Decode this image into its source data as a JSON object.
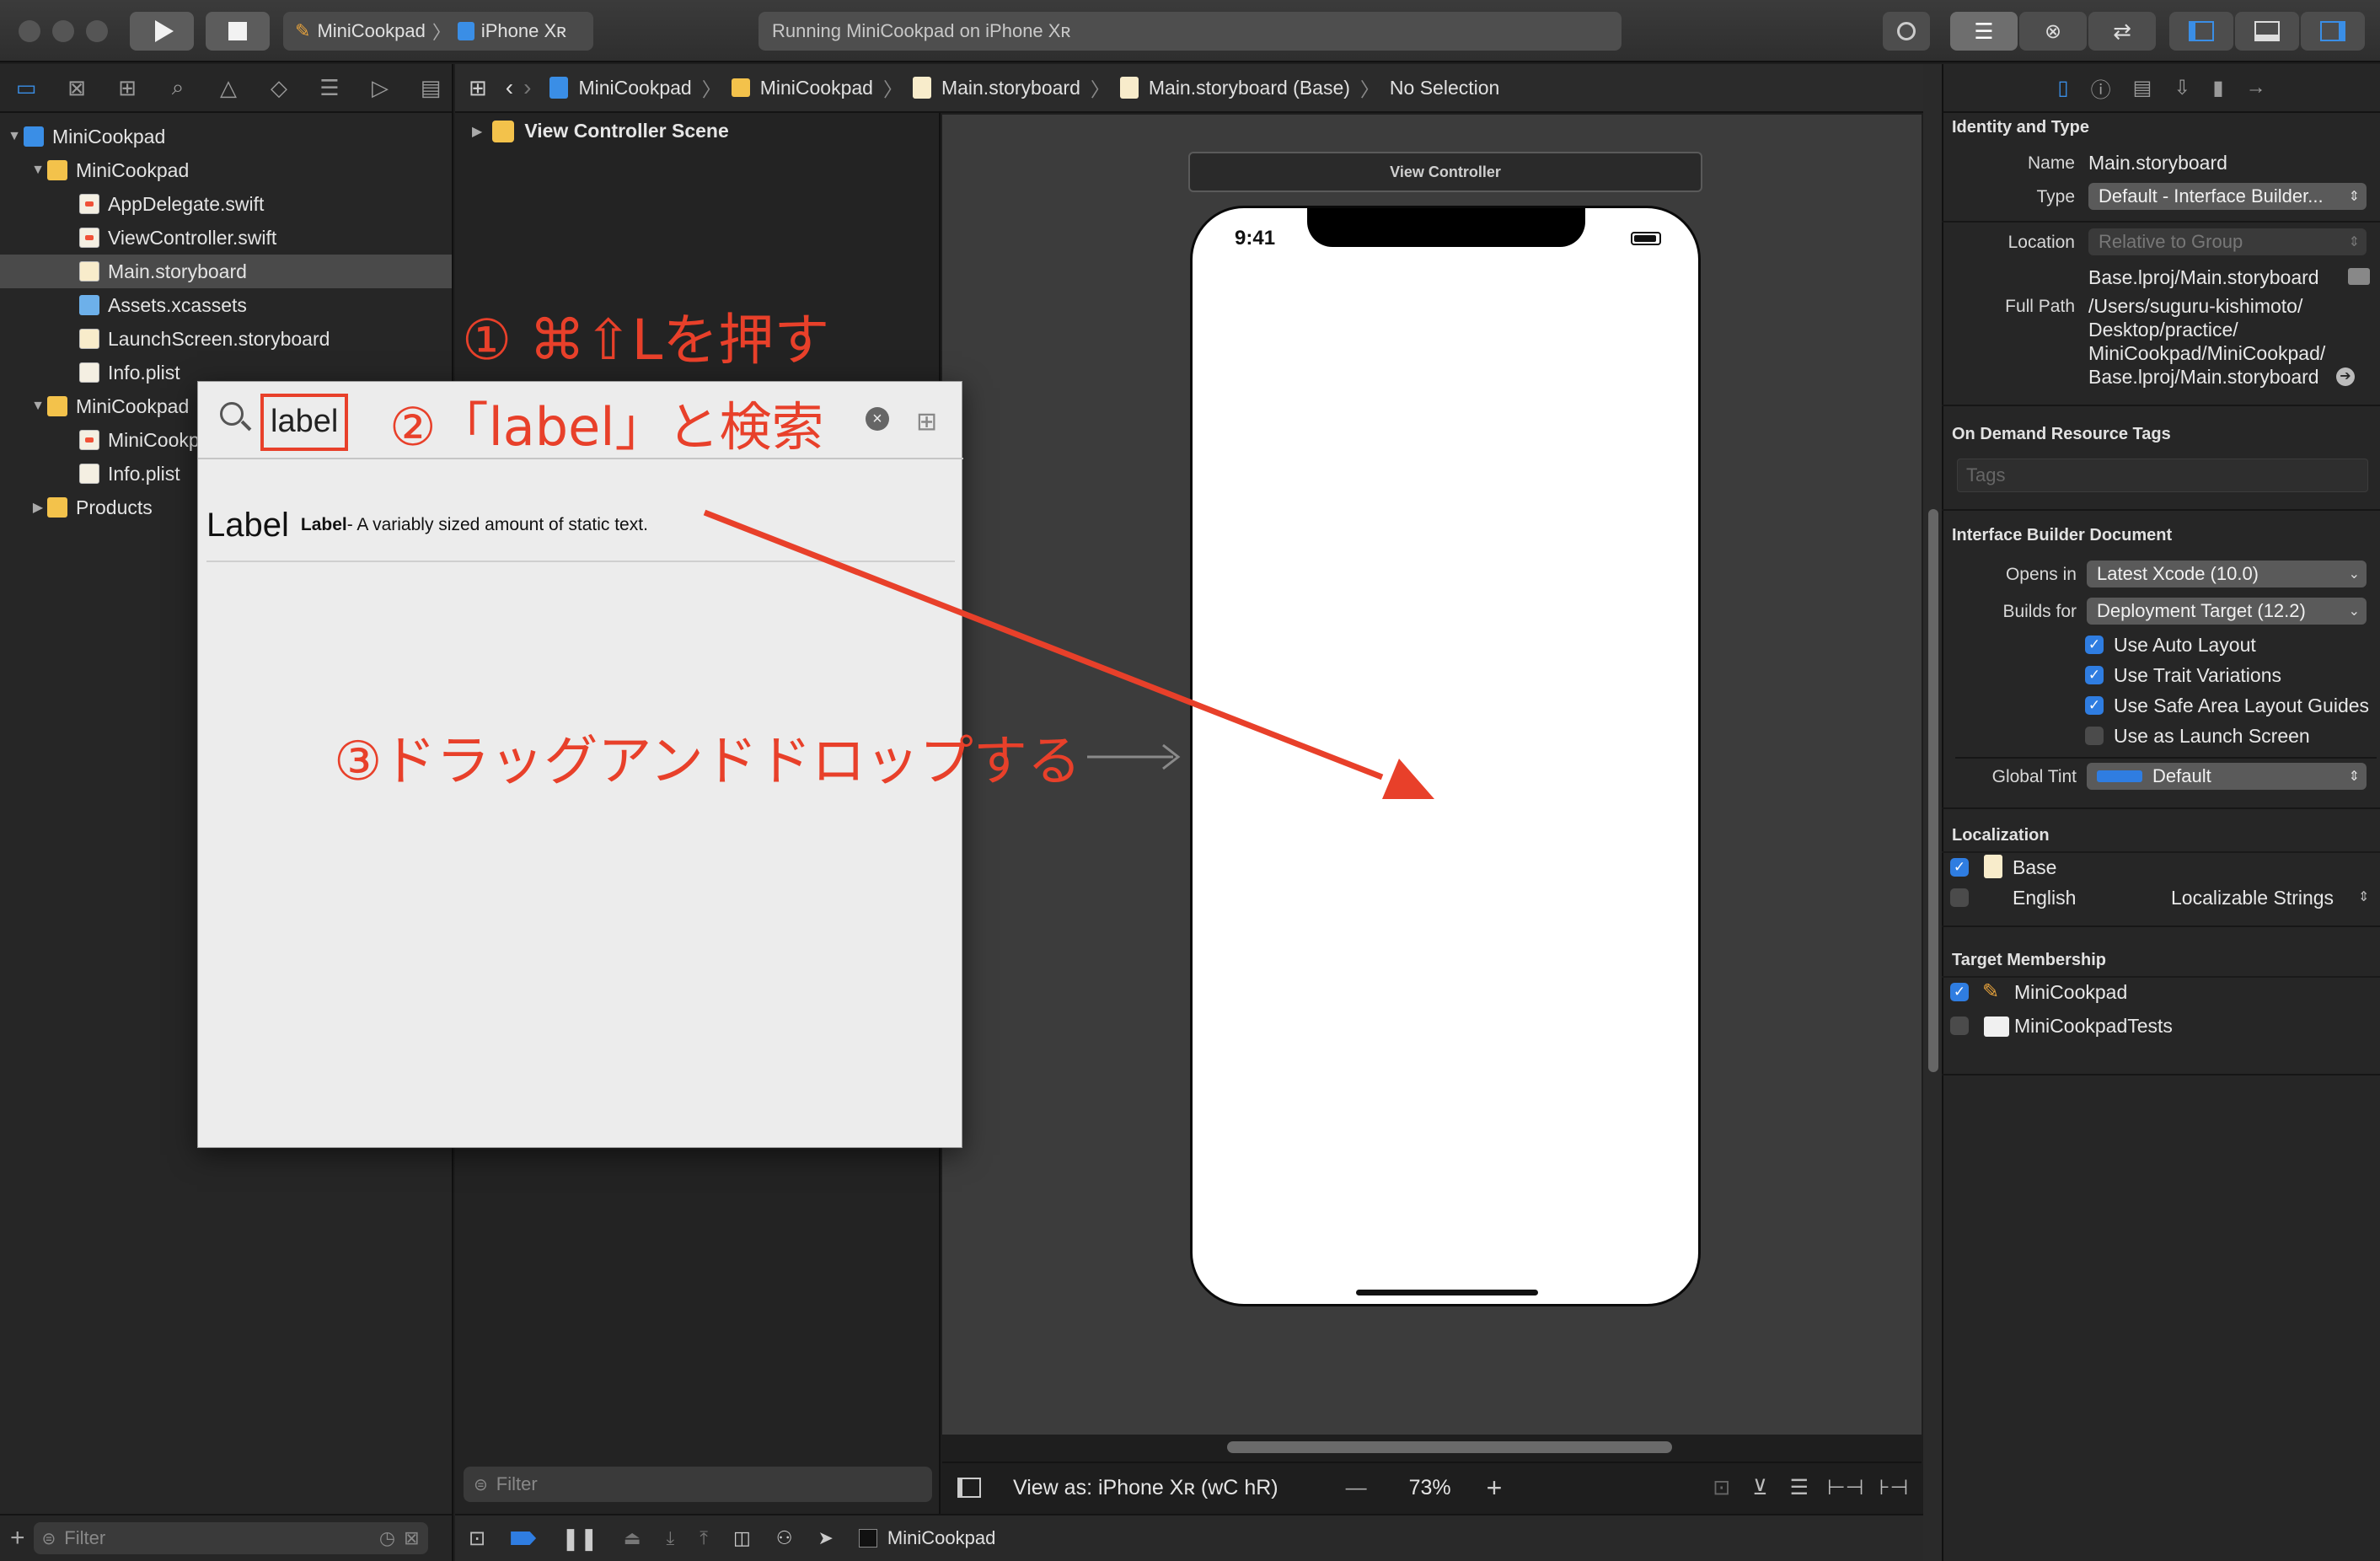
{
  "toolbar": {
    "scheme_name": "MiniCookpad",
    "scheme_separator": "〉",
    "device": "iPhone Xʀ",
    "status": "Running MiniCookpad on iPhone Xʀ"
  },
  "navigator": {
    "icons": [
      "folder-icon",
      "source-control-icon",
      "hierarchy-icon",
      "search-icon",
      "warning-icon",
      "test-diamond-icon",
      "debug-icon",
      "breakpoint-icon",
      "report-icon"
    ],
    "items": [
      {
        "label": "MiniCookpad",
        "kind": "project"
      },
      {
        "label": "MiniCookpad",
        "kind": "folder"
      },
      {
        "label": "AppDelegate.swift",
        "kind": "swift"
      },
      {
        "label": "ViewController.swift",
        "kind": "swift"
      },
      {
        "label": "Main.storyboard",
        "kind": "storyboard"
      },
      {
        "label": "Assets.xcassets",
        "kind": "assets"
      },
      {
        "label": "LaunchScreen.storyboard",
        "kind": "storyboard"
      },
      {
        "label": "Info.plist",
        "kind": "plist"
      },
      {
        "label": "MiniCookpad",
        "kind": "folder"
      },
      {
        "label": "MiniCookp",
        "kind": "swift"
      },
      {
        "label": "Info.plist",
        "kind": "plist"
      },
      {
        "label": "Products",
        "kind": "folder"
      }
    ],
    "filter_placeholder": "Filter"
  },
  "jumpbar": {
    "items": [
      "MiniCookpad",
      "MiniCookpad",
      "Main.storyboard",
      "Main.storyboard (Base)",
      "No Selection"
    ]
  },
  "outline": {
    "scene": "View Controller Scene",
    "filter_placeholder": "Filter"
  },
  "canvas": {
    "vc_title": "View Controller",
    "phone_time": "9:41",
    "view_as": "View as: iPhone Xʀ (",
    "size_class_w": "wC",
    "size_class_h": "hR",
    "view_as_close": ")",
    "zoom": "73%",
    "zoom_minus": "—",
    "zoom_plus": "+"
  },
  "debug": {
    "target": "MiniCookpad"
  },
  "library": {
    "search_value": "label",
    "result_title": "Label",
    "result_name": "Label",
    "result_desc": " - A variably sized amount of static text."
  },
  "annotations": {
    "step1": "① ⌘⇧Lを押す",
    "step2": "②「label」と検索",
    "step3": "③ドラッグアンドドロップする"
  },
  "inspector": {
    "identity_header": "Identity and Type",
    "name_label": "Name",
    "name_value": "Main.storyboard",
    "type_label": "Type",
    "type_value": "Default - Interface Builder...",
    "location_label": "Location",
    "location_value": "Relative to Group",
    "location_path": "Base.lproj/Main.storyboard",
    "fullpath_label": "Full Path",
    "fullpath_lines": [
      "/Users/suguru-kishimoto/",
      "Desktop/practice/",
      "MiniCookpad/MiniCookpad/",
      "Base.lproj/Main.storyboard"
    ],
    "odr_header": "On Demand Resource Tags",
    "tags_placeholder": "Tags",
    "ibd_header": "Interface Builder Document",
    "opens_label": "Opens in",
    "opens_value": "Latest Xcode (10.0)",
    "builds_label": "Builds for",
    "builds_value": "Deployment Target (12.2)",
    "checks": [
      {
        "label": "Use Auto Layout",
        "checked": true
      },
      {
        "label": "Use Trait Variations",
        "checked": true
      },
      {
        "label": "Use Safe Area Layout Guides",
        "checked": true
      },
      {
        "label": "Use as Launch Screen",
        "checked": false
      }
    ],
    "tint_label": "Global Tint",
    "tint_value": "Default",
    "tint_color": "#2f7de1",
    "loc_header": "Localization",
    "loc_base": "Base",
    "loc_english": "English",
    "loc_english_value": "Localizable Strings",
    "membership_header": "Target Membership",
    "member1": "MiniCookpad",
    "member2": "MiniCookpadTests"
  }
}
